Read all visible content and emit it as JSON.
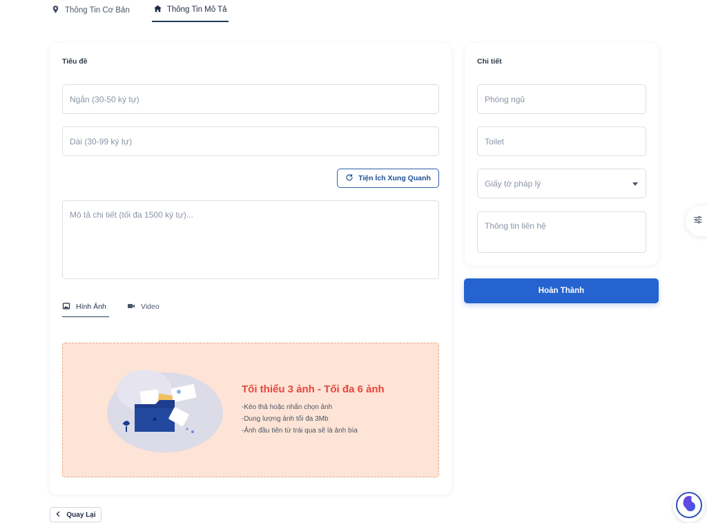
{
  "top_tabs": [
    {
      "label": "Thông Tin Cơ Bản",
      "icon": "location-pin-icon",
      "active": false
    },
    {
      "label": "Thông Tin Mô Tả",
      "icon": "home-icon",
      "active": true
    }
  ],
  "title_section": {
    "heading": "Tiêu đề",
    "short_placeholder": "Ngắn (30-50 ký tự)",
    "long_placeholder": "Dài (30-99 ký tự)",
    "amenities_button": "Tiện Ích Xung Quanh",
    "description_placeholder": "Mô tả chi tiết (tối đa 1500 ký tự)..."
  },
  "media_tabs": [
    {
      "label": "Hình Ảnh",
      "icon": "image-icon",
      "active": true
    },
    {
      "label": "Video",
      "icon": "video-camera-icon",
      "active": false
    }
  ],
  "upload": {
    "title": "Tối thiểu 3 ảnh - Tối đa 6 ảnh",
    "rules": [
      "-Kéo thả hoặc nhấn chọn ảnh",
      "-Dung lượng ảnh tối đa 3Mb",
      "-Ảnh đầu tiên từ trái qua sẽ là ảnh bìa"
    ]
  },
  "details": {
    "heading": "Chi tiết",
    "bedrooms_placeholder": "Phòng ngủ",
    "toilet_placeholder": "Toilet",
    "legal_docs_placeholder": "Giấy tờ pháp lý",
    "contact_placeholder": "Thông tin liên hệ"
  },
  "actions": {
    "submit": "Hoàn Thành",
    "back": "Quay Lại"
  },
  "colors": {
    "primary": "#2563d0",
    "upload_bg": "#fde4d6",
    "upload_title": "#e8453c"
  }
}
